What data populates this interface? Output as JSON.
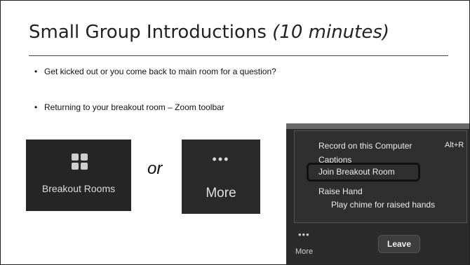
{
  "slide": {
    "title_main": "Small Group Introductions ",
    "title_italic": "(10 minutes)",
    "bullets": [
      "Get kicked out or you come back to main room for a question?",
      "Returning to your breakout room – Zoom toolbar"
    ],
    "or_label": "or"
  },
  "breakout_tile": {
    "icon": "grid-icon",
    "label": "Breakout Rooms"
  },
  "more_tile": {
    "icon": "more-dots-icon",
    "dots": "•••",
    "label": "More"
  },
  "zoom_menu": {
    "items": [
      {
        "label": "Record on this Computer",
        "shortcut": "Alt+R"
      },
      {
        "label": "Captions"
      },
      {
        "label": "Join Breakout Room"
      },
      {
        "label": "Raise Hand"
      },
      {
        "label": "Play chime for raised hands"
      }
    ]
  },
  "zoom_toolbar": {
    "more_dots": "•••",
    "more_label": "More",
    "leave_label": "Leave"
  },
  "colors": {
    "toolbar_bg": "#262626",
    "menu_bg": "#2f2f2f",
    "highlight_border": "#111111"
  }
}
